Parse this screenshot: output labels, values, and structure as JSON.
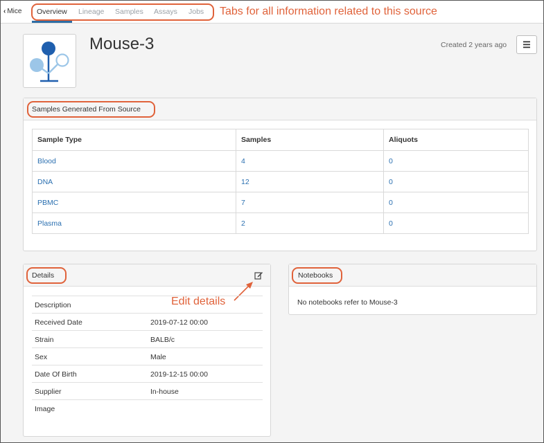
{
  "nav": {
    "back_label": "Mice",
    "tabs": [
      {
        "label": "Overview"
      },
      {
        "label": "Lineage"
      },
      {
        "label": "Samples"
      },
      {
        "label": "Assays"
      },
      {
        "label": "Jobs"
      }
    ]
  },
  "annotations": {
    "tabs_note": "Tabs for all information related to this source",
    "edit_note": "Edit details"
  },
  "header": {
    "title": "Mouse-3",
    "created": "Created 2 years ago",
    "menu_icon": "hamburger-icon"
  },
  "samples_panel": {
    "title": "Samples Generated From Source",
    "columns": [
      "Sample Type",
      "Samples",
      "Aliquots"
    ],
    "rows": [
      [
        "Blood",
        "4",
        "0"
      ],
      [
        "DNA",
        "12",
        "0"
      ],
      [
        "PBMC",
        "7",
        "0"
      ],
      [
        "Plasma",
        "2",
        "0"
      ]
    ]
  },
  "details_panel": {
    "title": "Details",
    "edit_icon": "edit-icon",
    "fields": [
      {
        "key": "Description",
        "value": ""
      },
      {
        "key": "Received Date",
        "value": "2019-07-12 00:00"
      },
      {
        "key": "Strain",
        "value": "BALB/c"
      },
      {
        "key": "Sex",
        "value": "Male"
      },
      {
        "key": "Date Of Birth",
        "value": "2019-12-15 00:00"
      },
      {
        "key": "Supplier",
        "value": "In-house"
      },
      {
        "key": "Image",
        "value": ""
      }
    ]
  },
  "notebooks_panel": {
    "title": "Notebooks",
    "empty_text": "No notebooks refer to Mouse-3"
  },
  "colors": {
    "accent": "#2e6da4",
    "link": "#2a6fb0",
    "annotation": "#e0623a"
  }
}
